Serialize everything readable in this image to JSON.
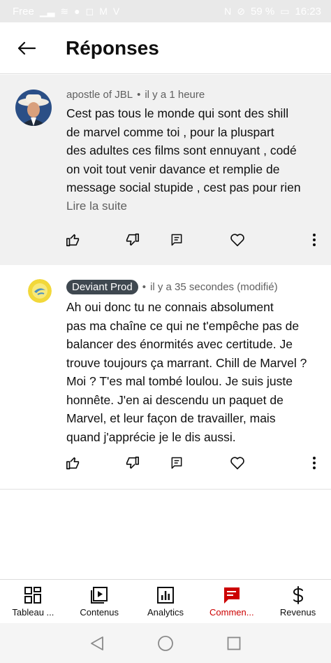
{
  "status_bar": {
    "carrier": "Free",
    "battery": "59 %",
    "time": "16:23"
  },
  "header": {
    "title": "Réponses"
  },
  "comments": [
    {
      "author": "apostle of JBL",
      "time": "il y a 1 heure",
      "text_lines": [
        "Cest pas tous le monde qui sont des shill",
        "de marvel comme toi , pour la pluspart",
        "des adultes ces films sont ennuyant , codé",
        "on voit tout venir davance et remplie de",
        "message social stupide , cest pas pour rien"
      ],
      "read_more": "Lire la suite"
    },
    {
      "author": "Deviant Prod",
      "time": "il y a 35 secondes (modifié)",
      "text_lines": [
        "Ah oui donc tu ne connais absolument",
        "pas ma chaîne ce qui ne t'empêche pas de",
        "balancer des énormités avec certitude. Je",
        "trouve toujours ça marrant. Chill de Marvel ?",
        "Moi ? T'es mal tombé loulou. Je suis juste",
        "honnête. J'en ai descendu un paquet de",
        "Marvel, et leur façon de travailler, mais",
        "quand j'apprécie je le dis aussi."
      ]
    }
  ],
  "bottom_nav": [
    {
      "label": "Tableau ...",
      "icon": "dashboard-icon",
      "active": false
    },
    {
      "label": "Contenus",
      "icon": "content-icon",
      "active": false
    },
    {
      "label": "Analytics",
      "icon": "analytics-icon",
      "active": false
    },
    {
      "label": "Commen...",
      "icon": "comments-icon",
      "active": true
    },
    {
      "label": "Revenus",
      "icon": "dollar-icon",
      "active": false
    }
  ],
  "colors": {
    "accent": "#cc0000",
    "badge": "#3f4850",
    "meta_text": "#606060"
  }
}
